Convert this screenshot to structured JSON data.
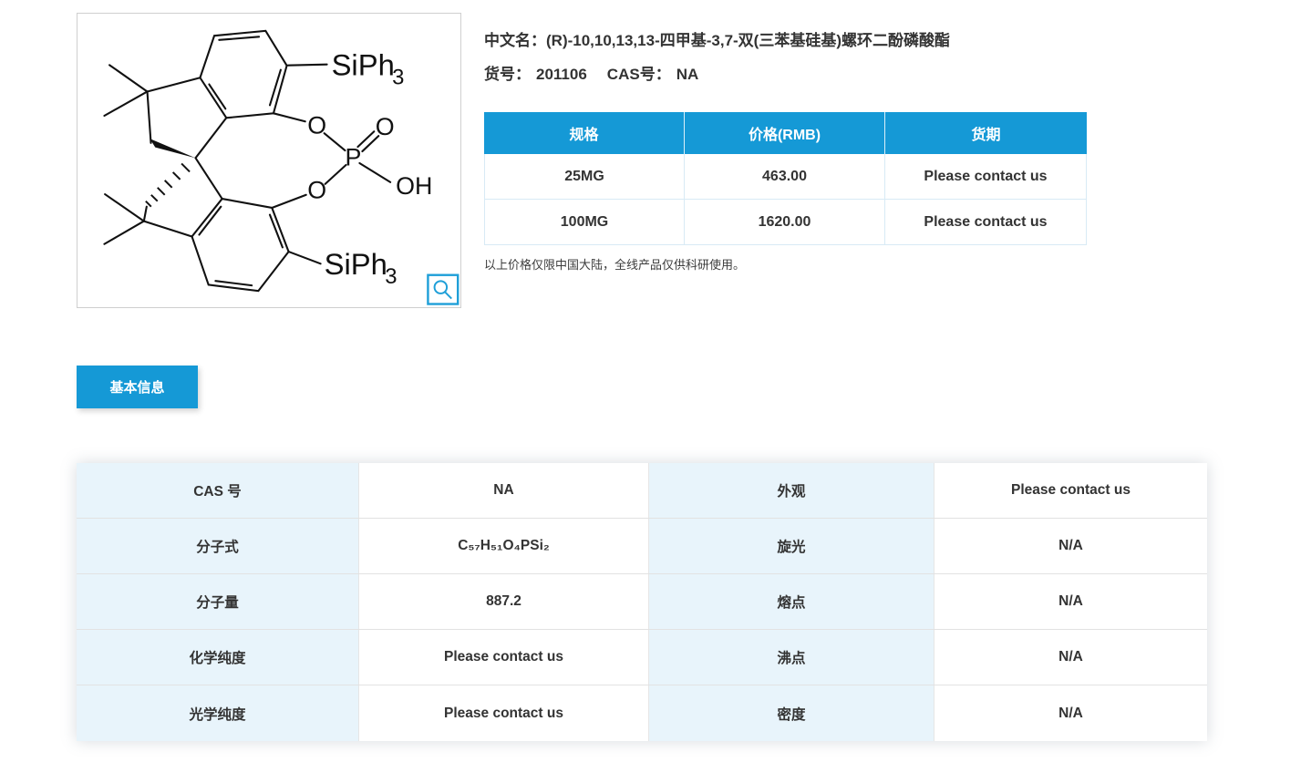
{
  "colors": {
    "accent": "#1599d6",
    "magnifier_blue": "#1e9fd8",
    "label_cell_bg": "#e8f4fb"
  },
  "product": {
    "name_label": "中文名：",
    "name": "(R)-10,10,13,13-四甲基-3,7-双(三苯基硅基)螺环二酚磷酸酯",
    "sku_label": "货号：",
    "sku": "201106",
    "cas_label": "CAS号：",
    "cas": "NA"
  },
  "price_table": {
    "headers": [
      "规格",
      "价格(RMB)",
      "货期"
    ],
    "rows": [
      [
        "25MG",
        "463.00",
        "Please contact us"
      ],
      [
        "100MG",
        "1620.00",
        "Please contact us"
      ]
    ],
    "note": "以上价格仅限中国大陆，全线产品仅供科研使用。"
  },
  "tabs": {
    "basic_info": "基本信息"
  },
  "info_table": {
    "rows": [
      {
        "label1": "CAS 号",
        "value1": "NA",
        "label2": "外观",
        "value2": "Please contact us"
      },
      {
        "label1": "分子式",
        "value1": "C₅₇H₅₁O₄PSi₂",
        "label2": "旋光",
        "value2": "N/A"
      },
      {
        "label1": "分子量",
        "value1": "887.2",
        "label2": "熔点",
        "value2": "N/A"
      },
      {
        "label1": "化学纯度",
        "value1": "Please contact us",
        "label2": "沸点",
        "value2": "N/A"
      },
      {
        "label1": "光学纯度",
        "value1": "Please contact us",
        "label2": "密度",
        "value2": "N/A"
      }
    ]
  },
  "structure": {
    "atom_o": "O",
    "atom_p": "P",
    "atom_oh": "OH",
    "siph": "SiPh",
    "siph_sub": "3"
  }
}
